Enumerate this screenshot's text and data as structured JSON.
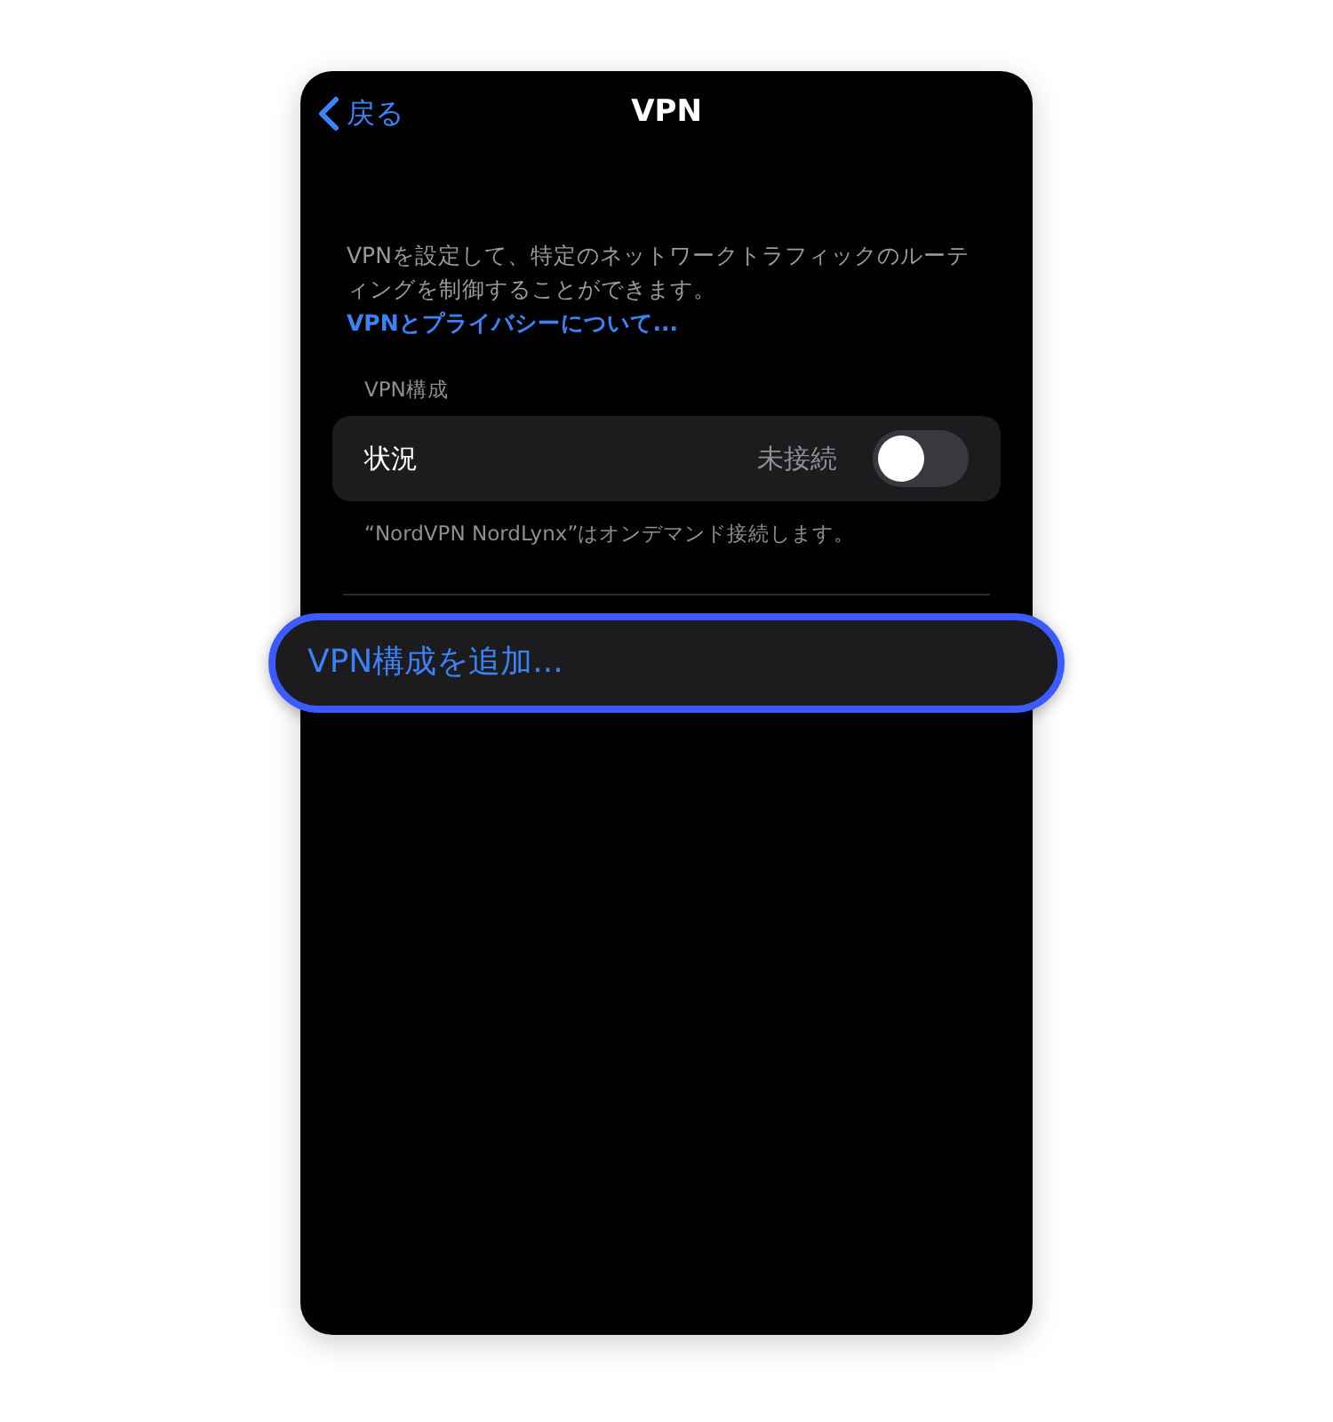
{
  "nav": {
    "back": "戻る",
    "title": "VPN"
  },
  "description": {
    "text": "VPNを設定して、特定のネットワークトラフィックのルーティングを制御することができます。",
    "link": "VPNとプライバシーについて..."
  },
  "section": {
    "header": "VPN構成",
    "row": {
      "label": "状況",
      "value": "未接続",
      "on": false
    },
    "footer": "“NordVPN NordLynx”はオンデマンド接続します。"
  },
  "add_button": {
    "label": "VPN構成を追加...",
    "highlighted": true
  }
}
